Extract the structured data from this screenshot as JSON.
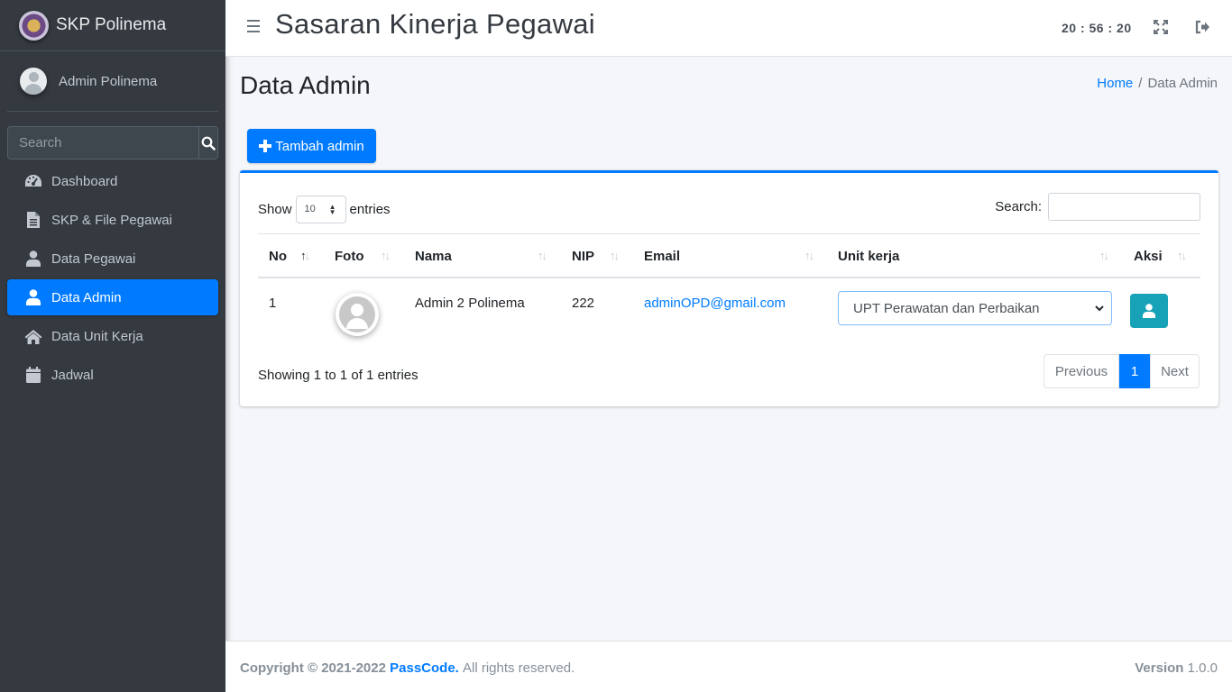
{
  "sidebar": {
    "brand": "SKP Polinema",
    "user": "Admin Polinema",
    "search_placeholder": "Search",
    "items": [
      {
        "label": "Dashboard",
        "icon": "dashboard-icon"
      },
      {
        "label": "SKP & File Pegawai",
        "icon": "file-icon"
      },
      {
        "label": "Data Pegawai",
        "icon": "user-icon"
      },
      {
        "label": "Data Admin",
        "icon": "user-icon",
        "active": true
      },
      {
        "label": "Data Unit Kerja",
        "icon": "home-icon"
      },
      {
        "label": "Jadwal",
        "icon": "calendar-icon"
      }
    ]
  },
  "header": {
    "title": "Sasaran Kinerja Pegawai",
    "clock": "20 : 56 : 20"
  },
  "page": {
    "title": "Data Admin",
    "breadcrumb_home": "Home",
    "breadcrumb_current": "Data Admin",
    "add_button": "Tambah admin"
  },
  "table": {
    "show_label": "Show",
    "length_value": "10",
    "entries_label": "entries",
    "search_label": "Search:",
    "columns": [
      "No",
      "Foto",
      "Nama",
      "NIP",
      "Email",
      "Unit kerja",
      "Aksi"
    ],
    "rows": [
      {
        "no": "1",
        "nama": "Admin 2 Polinema",
        "nip": "222",
        "email": "adminOPD@gmail.com",
        "unit": "UPT Perawatan dan Perbaikan"
      }
    ],
    "info": "Showing 1 to 1 of 1 entries",
    "pagination": {
      "previous": "Previous",
      "current": "1",
      "next": "Next"
    }
  },
  "footer": {
    "copyright": "Copyright © 2021-2022",
    "brand": "PassCode.",
    "rights": "All rights reserved.",
    "version_label": "Version",
    "version": "1.0.0"
  },
  "colors": {
    "primary": "#007bff",
    "sidebar_bg": "#343a40",
    "info": "#17a2b8"
  }
}
